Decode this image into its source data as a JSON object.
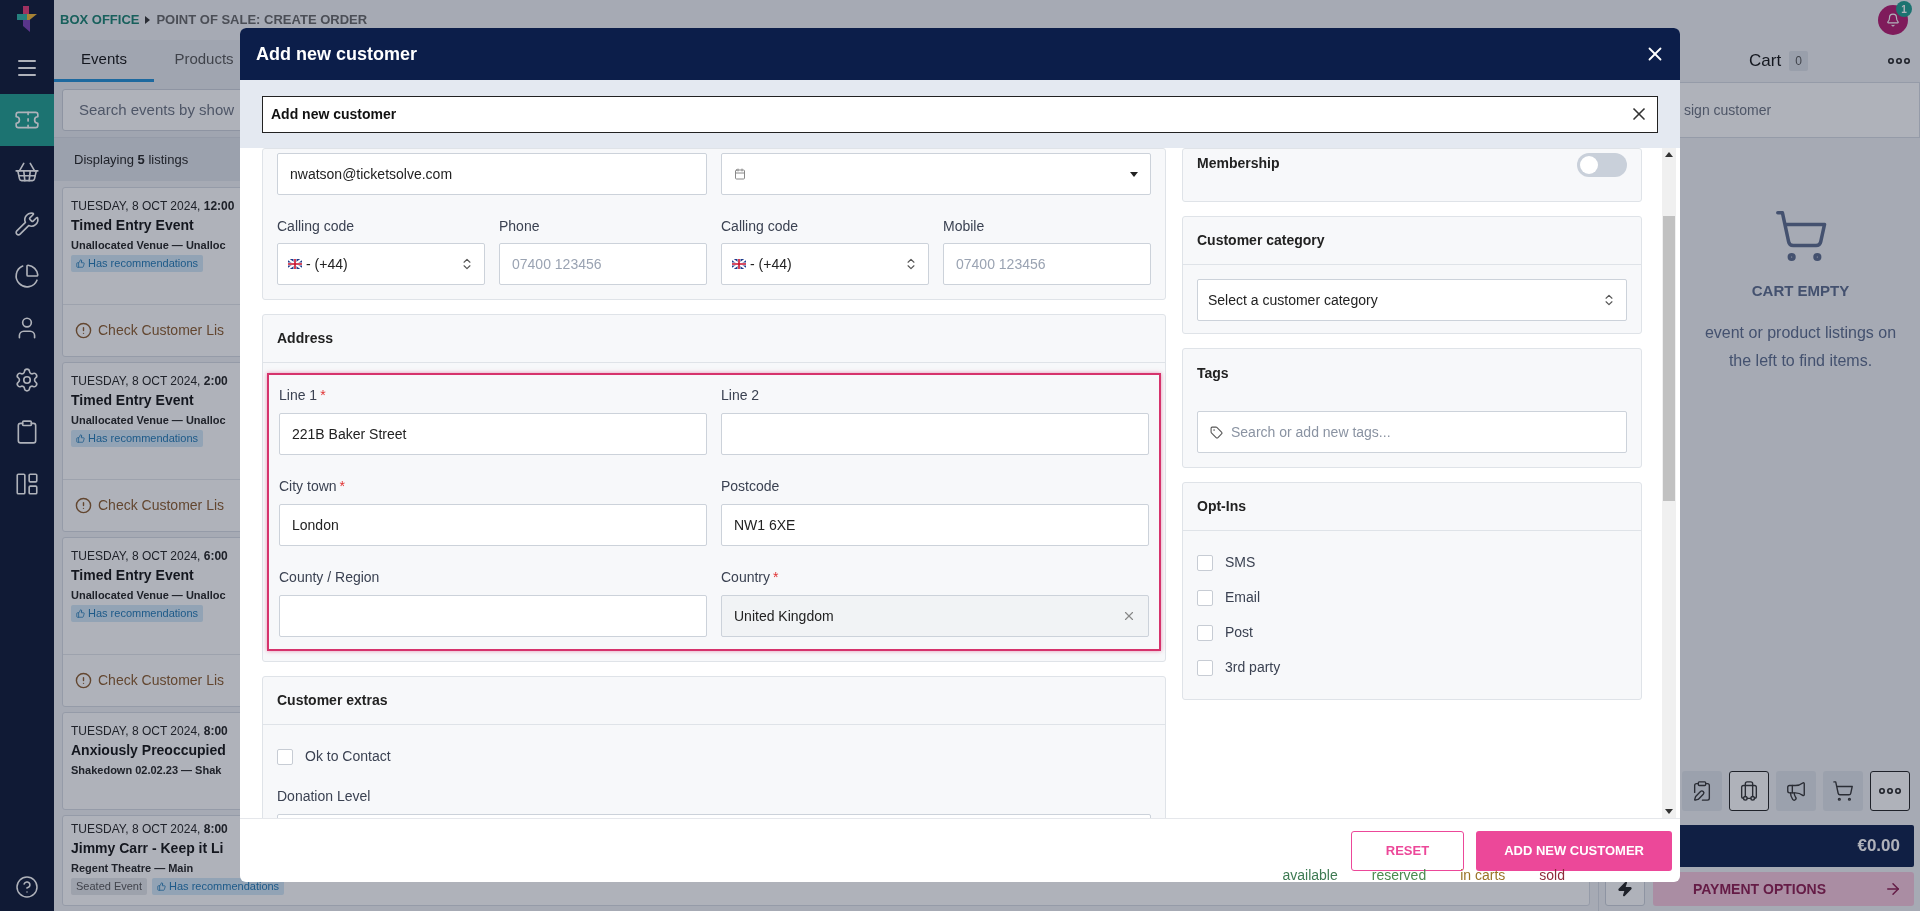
{
  "nav": {
    "items": [
      {
        "selected": true
      },
      {
        "selected": false
      },
      {
        "selected": false
      },
      {
        "selected": false
      },
      {
        "selected": false
      },
      {
        "selected": false
      },
      {
        "selected": false
      },
      {
        "selected": false
      }
    ]
  },
  "breadcrumb": [
    "BOX OFFICE",
    "POINT OF SALE: CREATE ORDER"
  ],
  "notifications": {
    "count": "1"
  },
  "tabs": [
    {
      "label": "Events",
      "selected": true
    },
    {
      "label": "Products",
      "selected": false
    }
  ],
  "search": {
    "placeholder": "Search events by show"
  },
  "listing_count": "Displaying **5** listings",
  "events": [
    {
      "datetime": "TUESDAY, 8 OCT 2024, **12:00**",
      "title": "Timed Entry Event",
      "venue": "Unallocated Venue — Unalloc",
      "tags": [
        {
          "label": "Has recommendations",
          "kind": "info"
        }
      ],
      "warning": "Check Customer Lis"
    },
    {
      "datetime": "TUESDAY, 8 OCT 2024, **2:00**",
      "title": "Timed Entry Event",
      "venue": "Unallocated Venue — Unalloc",
      "tags": [
        {
          "label": "Has recommendations",
          "kind": "info"
        }
      ],
      "warning": "Check Customer Lis"
    },
    {
      "datetime": "TUESDAY, 8 OCT 2024, **6:00**",
      "title": "Timed Entry Event",
      "venue": "Unallocated Venue — Unalloc",
      "tags": [
        {
          "label": "Has recommendations",
          "kind": "info"
        }
      ],
      "warning": "Check Customer Lis"
    },
    {
      "datetime": "TUESDAY, 8 OCT 2024, **8:00**",
      "title": "Anxiously Preoccupied",
      "venue": "Shakedown 02.02.23 — Shak"
    },
    {
      "datetime": "TUESDAY, 8 OCT 2024, **8:00**",
      "title": "Jimmy Carr - Keep it Li",
      "venue": "Regent Theatre — Main",
      "tags": [
        {
          "label": "Seated Event",
          "kind": "plain"
        },
        {
          "label": "Has recommendations",
          "kind": "info"
        }
      ],
      "legend": [
        {
          "label": "available",
          "color": "#3d7a52"
        },
        {
          "label": "reserved",
          "color": "#4a8a4e"
        },
        {
          "label": "in carts",
          "color": "#9a7428"
        },
        {
          "label": "sold",
          "color": "#8e2a3a"
        }
      ]
    }
  ],
  "cart": {
    "title": "Cart",
    "count": "0",
    "customer_placeholder": "sign customer",
    "empty_title": "CART EMPTY",
    "empty_text": "event or product listings on the left to find items.",
    "tools": [
      {
        "selected": false
      },
      {
        "selected": true
      },
      {
        "selected": false
      },
      {
        "selected": false
      }
    ],
    "total": "€0.00",
    "payment_button": {
      "label": "PAYMENT OPTIONS",
      "disabled": true
    }
  },
  "modal": {
    "title": "Add new customer",
    "search_value": "Add new customer",
    "contact": {
      "email": "nwatson@ticketsolve.com",
      "phones": [
        {
          "code_label": "Calling code",
          "code": "- (+44)",
          "label": "Phone",
          "placeholder": "07400 123456"
        },
        {
          "code_label": "Calling code",
          "code": "- (+44)",
          "label": "Mobile",
          "placeholder": "07400 123456"
        }
      ]
    },
    "address": {
      "title": "Address",
      "highlighted": true,
      "fields": [
        {
          "label": "Line 1",
          "required_mark": "*",
          "value": "221B Baker Street",
          "kind": "text"
        },
        {
          "label": "Line 2",
          "kind": "text"
        },
        {
          "label": "City town",
          "required_mark": "*",
          "value": "London",
          "kind": "text"
        },
        {
          "label": "Postcode",
          "value": "NW1 6XE",
          "kind": "text"
        },
        {
          "label": "County / Region",
          "kind": "text"
        },
        {
          "label": "Country",
          "required_mark": "*",
          "value": "United Kingdom",
          "kind": "select"
        }
      ]
    },
    "extras": {
      "title": "Customer extras",
      "checkboxes": [
        {
          "label": "Ok to Contact",
          "checked": false
        }
      ],
      "donation_label": "Donation Level"
    },
    "membership": {
      "label": "Membership",
      "on": false
    },
    "category": {
      "title": "Customer category",
      "placeholder": "Select a customer category"
    },
    "tags": {
      "title": "Tags",
      "placeholder": "Search or add new tags..."
    },
    "opt_ins": {
      "title": "Opt-Ins",
      "items": [
        {
          "label": "SMS",
          "checked": false
        },
        {
          "label": "Email",
          "checked": false
        },
        {
          "label": "Post",
          "checked": false
        },
        {
          "label": "3rd party",
          "checked": false
        }
      ]
    },
    "buttons": [
      {
        "label": "RESET",
        "kind": "outline"
      },
      {
        "label": "ADD NEW CUSTOMER",
        "kind": "primary"
      }
    ]
  }
}
